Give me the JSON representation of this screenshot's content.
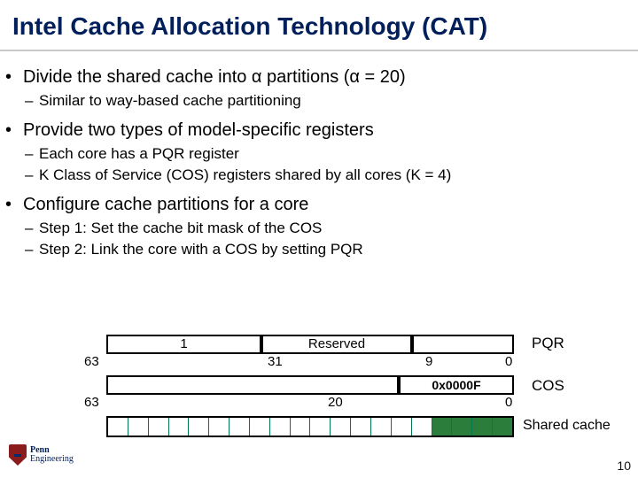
{
  "slide": {
    "title": "Intel Cache Allocation Technology (CAT)",
    "bullets": {
      "b1": "Divide the shared cache into α partitions (α = 20)",
      "b1_1": "Similar to way-based cache partitioning",
      "b2": "Provide two types of model-specific registers",
      "b2_1": "Each core has a PQR register",
      "b2_2": "K Class of Service (COS) registers shared by all cores (K = 4)",
      "b3": "Configure cache partitions for a core",
      "b3_1": "Step 1: Set the cache bit mask of the COS",
      "b3_2": "Step 2: Link the core with a COS by setting PQR"
    },
    "pqr": {
      "label": "PQR",
      "cos_field": "1",
      "reserved_field": "Reserved",
      "bit63": "63",
      "bit31": "31",
      "bit9": "9",
      "bit0": "0"
    },
    "cos": {
      "label": "COS",
      "mask_field": "0x0000F",
      "bit63": "63",
      "bit20": "20",
      "bit0": "0"
    },
    "cache_label": "Shared cache",
    "logo": {
      "line1": "Penn",
      "line2": "Engineering"
    },
    "page_number": "10"
  }
}
